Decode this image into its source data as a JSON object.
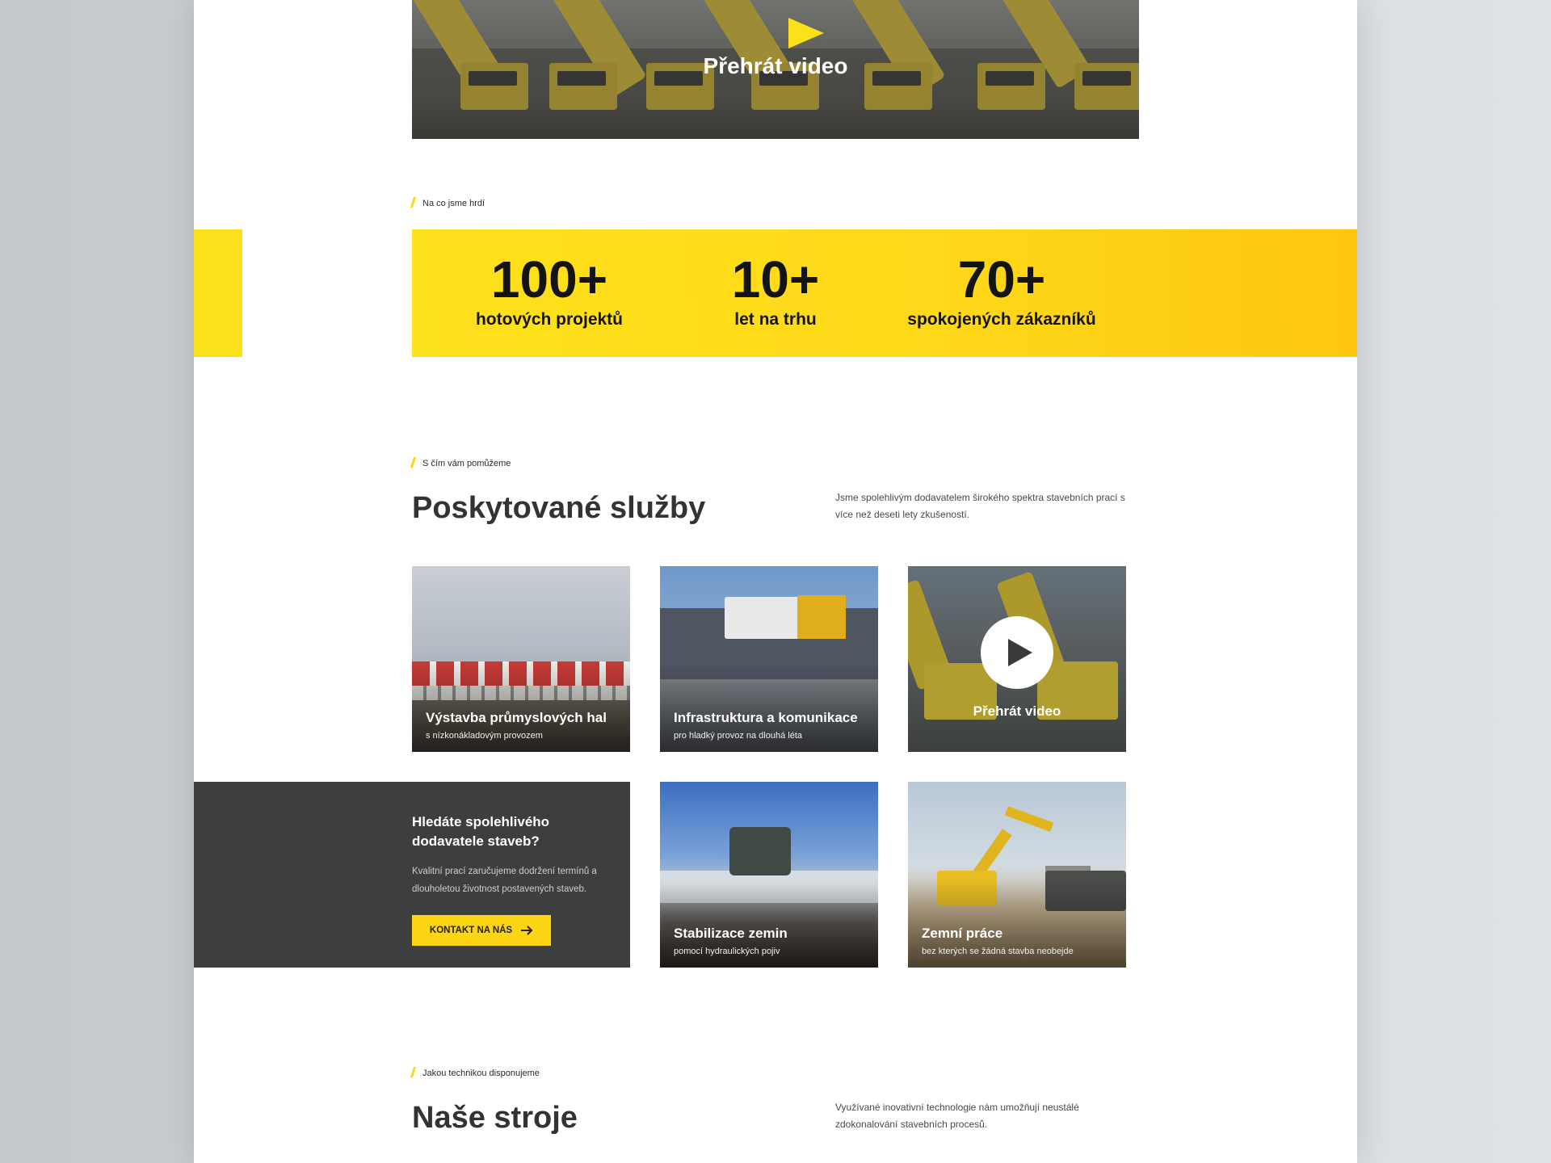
{
  "hero_video": {
    "label": "Přehrát video",
    "icon": "play-triangle-icon"
  },
  "stats_section": {
    "tag": "Na co jsme hrdí",
    "items": [
      {
        "value": "100+",
        "label": "hotových projektů"
      },
      {
        "value": "10+",
        "label": "let na trhu"
      },
      {
        "value": "70+",
        "label": "spokojených zákazníků"
      }
    ]
  },
  "services_section": {
    "tag": "S čím vám pomůžeme",
    "title": "Poskytované služby",
    "intro": "Jsme spolehlivým dodavatelem širokého spektra stavebních prací s více než deseti lety zkušeností.",
    "cards": [
      {
        "title": "Výstavba průmyslových hal",
        "subtitle": "s nízkonákladovým provozem"
      },
      {
        "title": "Infrastruktura a komunikace",
        "subtitle": "pro hladký provoz na dlouhá léta"
      },
      {
        "title": "Přehrát video",
        "subtitle": ""
      },
      {
        "title": "Stabilizace zemin",
        "subtitle": "pomocí hydraulických pojiv"
      },
      {
        "title": "Zemní práce",
        "subtitle": "bez kterých se žádná stavba neobejde"
      }
    ],
    "cta": {
      "title": "Hledáte spolehlivého dodavatele staveb?",
      "text": "Kvalitní prací zaručujeme dodržení termínů a dlouholetou životnost postavených staveb.",
      "button_label": "KONTAKT NA NÁS",
      "button_icon": "arrow-right-icon"
    }
  },
  "machines_section": {
    "tag": "Jakou technikou disponujeme",
    "title": "Naše stroje",
    "intro": "Využívané inovativní technologie nám umožňují neustálé zdokonalování stavebních procesů."
  },
  "colors": {
    "accent": "#fcd615",
    "dark": "#3e3e3e",
    "heading": "#333333"
  }
}
